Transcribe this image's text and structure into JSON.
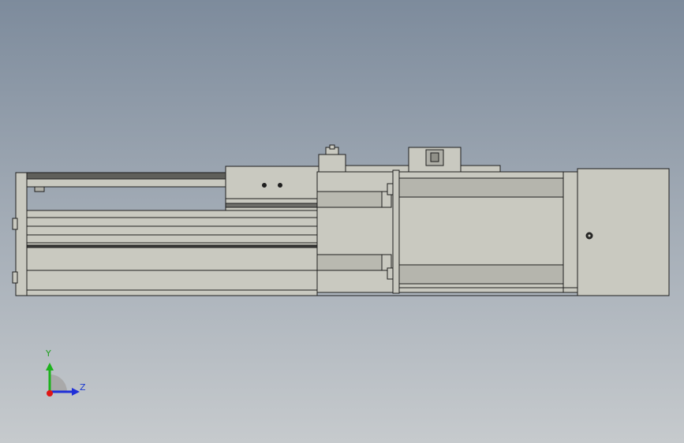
{
  "viewport": {
    "background_top": "#7d8b9c",
    "background_bottom": "#c6cacd",
    "part_color": "#c9c9c0",
    "edge_color": "#1e1e1e"
  },
  "triad": {
    "y_label": "Y",
    "z_label": "Z",
    "y_color": "#1db21d",
    "z_color": "#2030d8",
    "x_color": "#e01515",
    "label_y_color": "#20a020",
    "label_z_color": "#1a3ad0"
  }
}
